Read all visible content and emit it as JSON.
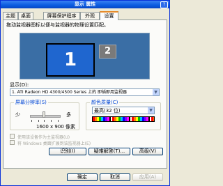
{
  "window": {
    "title": "显示 属性",
    "help": "?"
  },
  "tabs": [
    "主题",
    "桌面",
    "屏幕保护程序",
    "外观",
    "设置"
  ],
  "settings": {
    "description": "拖动监视器图标以便与监视器的物理设置匹配。",
    "monitors": [
      "1",
      "2"
    ],
    "display_label": "显示(D):",
    "display_value": "1. ATI Radeon HD 4300/4500 Series 上的 即插即用监视器",
    "resolution": {
      "title": "屏幕分辨率(S)",
      "less": "少",
      "more": "多",
      "value": "1600 x 900 像素"
    },
    "color": {
      "title": "颜色质量(C)",
      "value": "最高(32 位)"
    },
    "checkbox_primary": "使用该设备作为主监视器(U)",
    "checkbox_extend": "将 Windows 桌面扩展到该监视器上(E)",
    "buttons": {
      "identify": "识别(I)",
      "troubleshoot": "疑难解答(T)...",
      "advanced": "高级(V)"
    }
  },
  "dialog_buttons": {
    "ok": "确定",
    "cancel": "取消",
    "apply": "应用(A)"
  }
}
